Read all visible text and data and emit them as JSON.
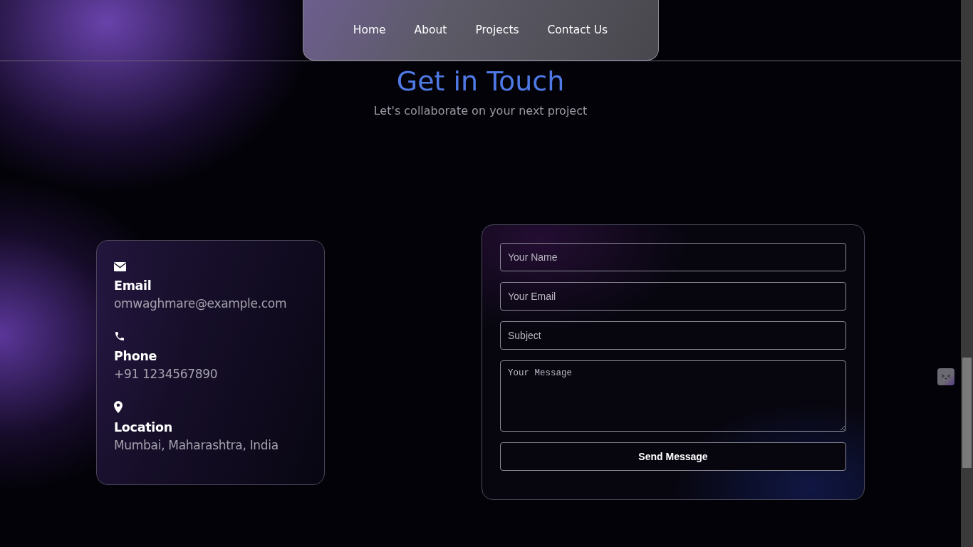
{
  "nav": {
    "items": [
      {
        "label": "Home"
      },
      {
        "label": "About"
      },
      {
        "label": "Projects"
      },
      {
        "label": "Contact Us"
      }
    ]
  },
  "heading": "Get in Touch",
  "subtitle": "Let's collaborate on your next project",
  "contact_items": [
    {
      "kind": "email",
      "label": "Email",
      "value": "omwaghmare@example.com"
    },
    {
      "kind": "phone",
      "label": "Phone",
      "value": "+91 1234567890"
    },
    {
      "kind": "location",
      "label": "Location",
      "value": "Mumbai, Maharashtra, India"
    }
  ],
  "form": {
    "fields": [
      {
        "kind": "input",
        "placeholder": "Your Name"
      },
      {
        "kind": "input",
        "placeholder": "Your Email"
      },
      {
        "kind": "input",
        "placeholder": "Subject"
      },
      {
        "kind": "textarea",
        "placeholder": "Your Message"
      }
    ],
    "submit": "Send Message"
  }
}
